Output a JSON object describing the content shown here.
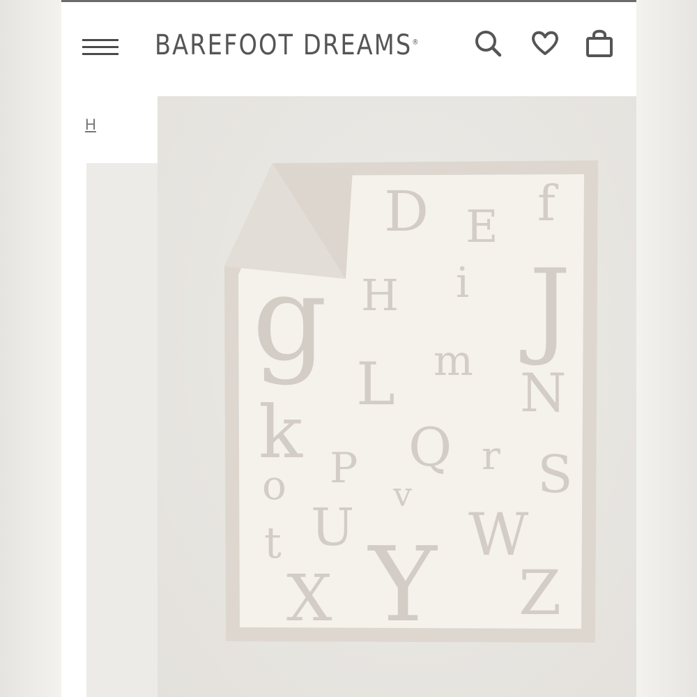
{
  "header": {
    "logo": "BAREFOOT DREAMS",
    "logo_mark": "®",
    "icons": [
      "menu-icon",
      "search-icon",
      "heart-icon",
      "bag-icon"
    ]
  },
  "breadcrumb": {
    "text": "H"
  },
  "product_image": {
    "letters": [
      "D",
      "E",
      "f",
      "g",
      "H",
      "i",
      "J",
      "L",
      "m",
      "N",
      "k",
      "P",
      "Q",
      "r",
      "S",
      "o",
      "v",
      "U",
      "W",
      "t",
      "X",
      "Y",
      "Z"
    ]
  },
  "colors": {
    "letter": "#d3cdc6",
    "blanket": "#f5f2ec",
    "border": "#ddd7d0",
    "text": "#555555"
  }
}
